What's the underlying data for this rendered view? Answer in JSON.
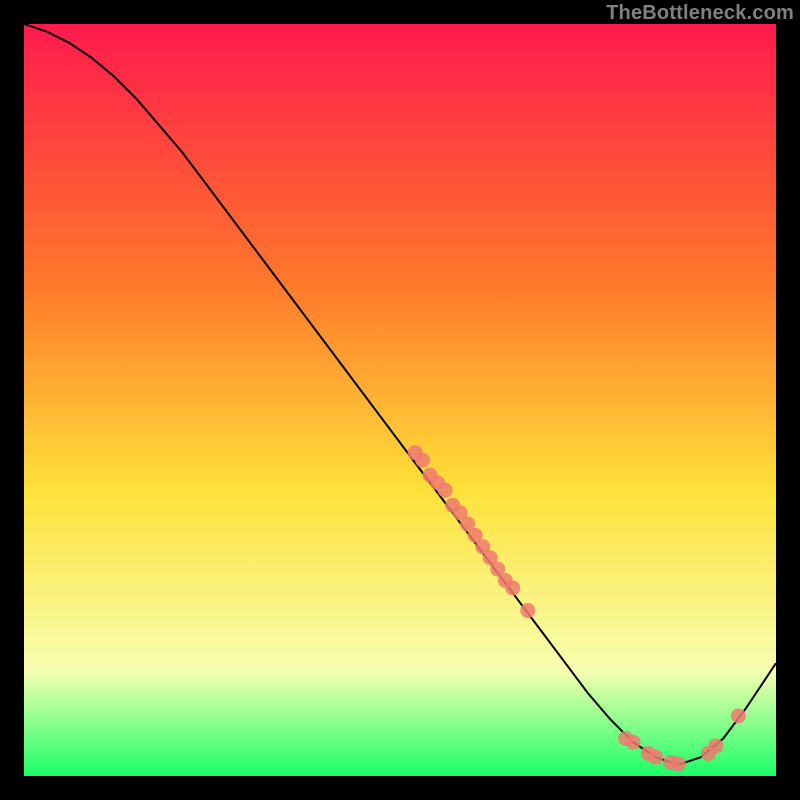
{
  "attribution": "TheBottleneck.com",
  "colors": {
    "background": "#000000",
    "gradient_top": "#ff1a4d",
    "gradient_mid1": "#ff7a2b",
    "gradient_mid2": "#ffe13a",
    "gradient_mid3": "#f6ffb0",
    "gradient_bottom": "#1cff66",
    "curve": "#000000",
    "marker": "#ee7a70",
    "attribution_text": "#808080"
  },
  "chart_data": {
    "type": "line",
    "title": "",
    "xlabel": "",
    "ylabel": "",
    "xlim": [
      0,
      100
    ],
    "ylim": [
      0,
      100
    ],
    "grid": false,
    "series": [
      {
        "name": "curve",
        "x": [
          0,
          3,
          6,
          9,
          12,
          15,
          18,
          21,
          24,
          27,
          30,
          33,
          36,
          39,
          42,
          45,
          48,
          51,
          54,
          57,
          60,
          63,
          66,
          69,
          72,
          75,
          78,
          81,
          84,
          87,
          90,
          93,
          96,
          100
        ],
        "y": [
          100,
          99,
          97.5,
          95.5,
          93,
          90,
          86.5,
          83,
          79,
          75,
          71,
          67,
          63,
          59,
          55,
          51,
          47,
          43,
          39,
          35,
          31,
          27,
          23,
          19,
          15,
          11,
          7.5,
          4.5,
          2.5,
          1.5,
          2.5,
          5,
          9,
          15
        ]
      }
    ],
    "markers": [
      {
        "x": 52,
        "y": 43
      },
      {
        "x": 53,
        "y": 42
      },
      {
        "x": 54,
        "y": 40
      },
      {
        "x": 55,
        "y": 39
      },
      {
        "x": 56,
        "y": 38
      },
      {
        "x": 57,
        "y": 36
      },
      {
        "x": 58,
        "y": 35
      },
      {
        "x": 59,
        "y": 33.5
      },
      {
        "x": 60,
        "y": 32
      },
      {
        "x": 61,
        "y": 30.5
      },
      {
        "x": 62,
        "y": 29
      },
      {
        "x": 63,
        "y": 27.5
      },
      {
        "x": 64,
        "y": 26
      },
      {
        "x": 65,
        "y": 25
      },
      {
        "x": 67,
        "y": 22
      },
      {
        "x": 80,
        "y": 5
      },
      {
        "x": 81,
        "y": 4.5
      },
      {
        "x": 83,
        "y": 3
      },
      {
        "x": 84,
        "y": 2.5
      },
      {
        "x": 86,
        "y": 1.8
      },
      {
        "x": 87,
        "y": 1.6
      },
      {
        "x": 91,
        "y": 3
      },
      {
        "x": 92,
        "y": 4
      },
      {
        "x": 95,
        "y": 8
      }
    ]
  }
}
